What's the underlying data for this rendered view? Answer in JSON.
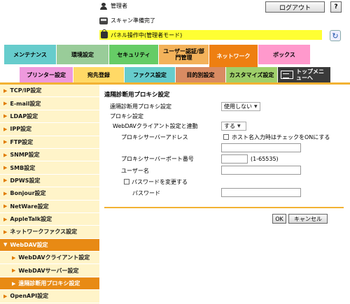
{
  "header": {
    "user_label": "管理者",
    "status_label": "スキャン準備完了",
    "panel_label": "パネル操作中(管理者モード)",
    "logout_label": "ログアウト",
    "help_label": "?"
  },
  "tabs_main": [
    {
      "label": "メンテナンス",
      "color": "#66cccc"
    },
    {
      "label": "環境設定",
      "color": "#99cc99"
    },
    {
      "label": "セキュリティ",
      "color": "#66cc66"
    },
    {
      "label": "ユーザー認証/部門管理",
      "color": "#f3b25a"
    },
    {
      "label": "ネットワーク",
      "color": "#ee7f11"
    },
    {
      "label": "ボックス",
      "color": "#ff99cc"
    }
  ],
  "tabs_sub": [
    {
      "label": "プリンター設定",
      "color": "#ee99dd"
    },
    {
      "label": "宛先登録",
      "color": "#ffd966"
    },
    {
      "label": "ファクス設定",
      "color": "#66cccc"
    },
    {
      "label": "目的別設定",
      "color": "#d98b62"
    },
    {
      "label": "カスタマイズ設定",
      "color": "#9fcf6a"
    },
    {
      "label": "トップメニューへ",
      "color": "#3a3a3a"
    }
  ],
  "sidebar": {
    "items": [
      {
        "label": "TCP/IP設定"
      },
      {
        "label": "E-mail設定"
      },
      {
        "label": "LDAP設定"
      },
      {
        "label": "IPP設定"
      },
      {
        "label": "FTP設定"
      },
      {
        "label": "SNMP設定"
      },
      {
        "label": "SMB設定"
      },
      {
        "label": "DPWS設定"
      },
      {
        "label": "Bonjour設定"
      },
      {
        "label": "NetWare設定"
      },
      {
        "label": "AppleTalk設定"
      },
      {
        "label": "ネットワークファクス設定"
      },
      {
        "label": "WebDAV設定"
      },
      {
        "label": "WebDAVクライアント設定"
      },
      {
        "label": "WebDAVサーバー設定"
      },
      {
        "label": "遠隔診断用プロキシ設定"
      },
      {
        "label": "OpenAPI設定"
      }
    ]
  },
  "form": {
    "title": "遠隔診断用プロキシ設定",
    "proxy_setting_label": "遠隔診断用プロキシ設定",
    "proxy_setting_value": "使用しない",
    "proxy_section_label": "プロキシ設定",
    "webdav_link_label": "WebDAVクライアント設定と連動",
    "webdav_link_value": "する",
    "server_address_label": "プロキシサーバーアドレス",
    "hostname_check_label": "ホスト名入力時はチェックをONにする",
    "server_address_value": "",
    "port_label": "プロキシサーバーポート番号",
    "port_value": "",
    "port_range": "(1-65535)",
    "username_label": "ユーザー名",
    "username_value": "",
    "change_password_label": "パスワードを変更する",
    "password_label": "パスワード",
    "password_value": "",
    "ok_label": "OK",
    "cancel_label": "キャンセル"
  }
}
